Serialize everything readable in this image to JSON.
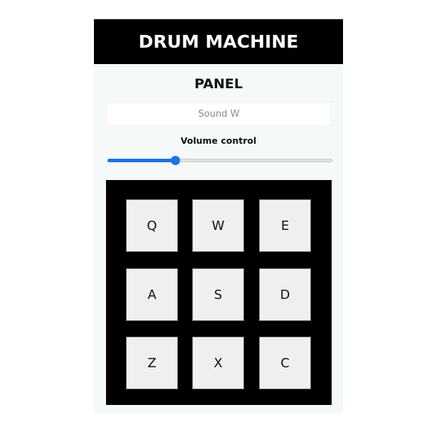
{
  "header": {
    "title": "DRUM MACHINE"
  },
  "panel": {
    "title": "PANEL",
    "display_text": "Sound W",
    "volume_label": "Volume control",
    "volume_value": 0.3,
    "accent_color": "#1a73e8"
  },
  "pads": [
    {
      "key": "Q"
    },
    {
      "key": "W"
    },
    {
      "key": "E"
    },
    {
      "key": "A"
    },
    {
      "key": "S"
    },
    {
      "key": "D"
    },
    {
      "key": "Z"
    },
    {
      "key": "X"
    },
    {
      "key": "C"
    }
  ]
}
